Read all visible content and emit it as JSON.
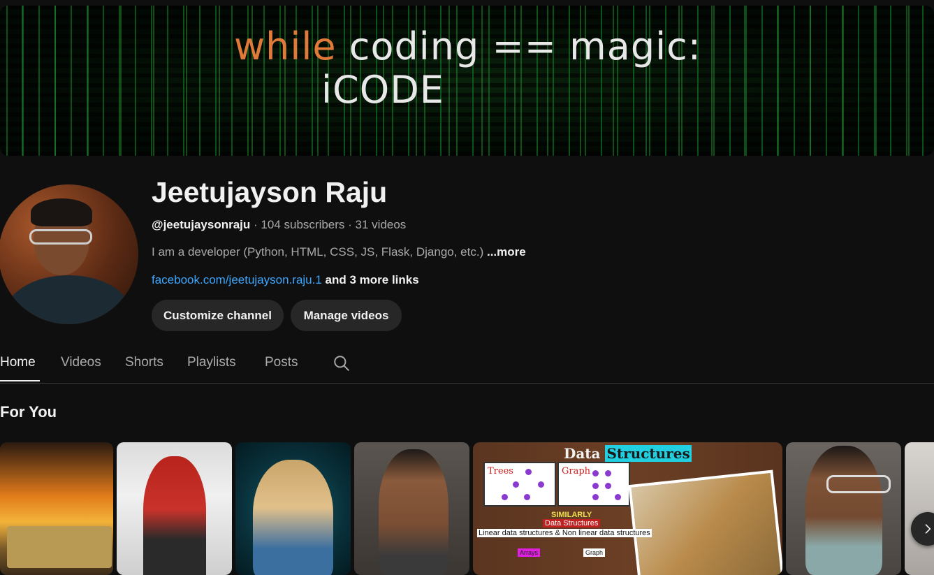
{
  "banner": {
    "keyword": "while",
    "rest_line1": " coding == magic:",
    "line2": "iCODE"
  },
  "channel": {
    "name": "Jeetujayson Raju",
    "handle": "@jeetujaysonraju",
    "separator1": " · ",
    "subscribers": "104 subscribers",
    "separator2": " · ",
    "videos": "31 videos",
    "description": "I am a developer (Python, HTML, CSS, JS, Flask, Django, etc.) ",
    "more_label": "...more",
    "link": "facebook.com/jeetujayson.raju.1",
    "more_links": " and 3 more links"
  },
  "actions": {
    "customize": "Customize channel",
    "manage": "Manage videos"
  },
  "tabs": [
    {
      "label": "Home"
    },
    {
      "label": "Videos"
    },
    {
      "label": "Shorts"
    },
    {
      "label": "Playlists"
    },
    {
      "label": "Posts"
    }
  ],
  "section": {
    "title": "For You"
  },
  "thumb5": {
    "title_plain": "Data ",
    "title_highlight": "Structures",
    "box1_label": "Trees",
    "box2_label": "Graph",
    "similarly": "SIMILARLY",
    "subtitle": "Data Structures",
    "line": "Linear data structures & Non linear data structures",
    "tag_array": "Arrays",
    "tag_graph": "Graph"
  },
  "icons": {
    "search": "search-icon",
    "next": "chevron-right-icon"
  }
}
